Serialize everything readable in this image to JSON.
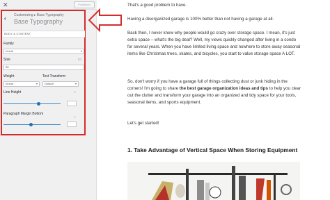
{
  "topbar": {
    "close_icon": "close-icon",
    "publish_label": "Published"
  },
  "panel": {
    "back_icon": "chevron-left-icon",
    "breadcrumb": "Customizing ▸ Base Typography",
    "title": "Base Typography",
    "group_label": "BODY & CONTENT",
    "family_label": "Family",
    "family_value": "Inherit",
    "size_label": "Size",
    "size_value": "20",
    "size_device_icon": "desktop-icon",
    "weight_label": "Weight",
    "weight_value": "Inherit",
    "transform_label": "Text Transform",
    "transform_value": "Default",
    "line_height_label": "Line Height",
    "line_height_level": 0.62,
    "margin_label": "Paragraph Margin Bottom",
    "margin_level": 0.48,
    "highlight_color": "#d62b2b"
  },
  "article": {
    "p1": "That's a good problem to have.",
    "p2": "Having a disorganized garage is 100% better than not having a garage at all.",
    "p3": "Back then, I never knew why people would go crazy over storage space. I mean, it's just extra space – what's the big deal? Well, my views quickly changed after living in a condo for several years. When you have limited living space and nowhere to store away seasonal items like Christmas trees, skates, and bicycles, you start to value storage space A LOT.",
    "p4_before": "So, don't worry if you have a garage full of things collecting dust or junk hiding in the corners! I'm going to share ",
    "p4_bold": "the best garage organization ideas and tips",
    "p4_after": " to help you clear out the clutter and transform your garage into an organized and tidy space for your tools, seasonal items, and sports equipment.",
    "p5": "Let's get started!",
    "heading": "1. Take Advantage of Vertical Space When Storing Equipment"
  }
}
